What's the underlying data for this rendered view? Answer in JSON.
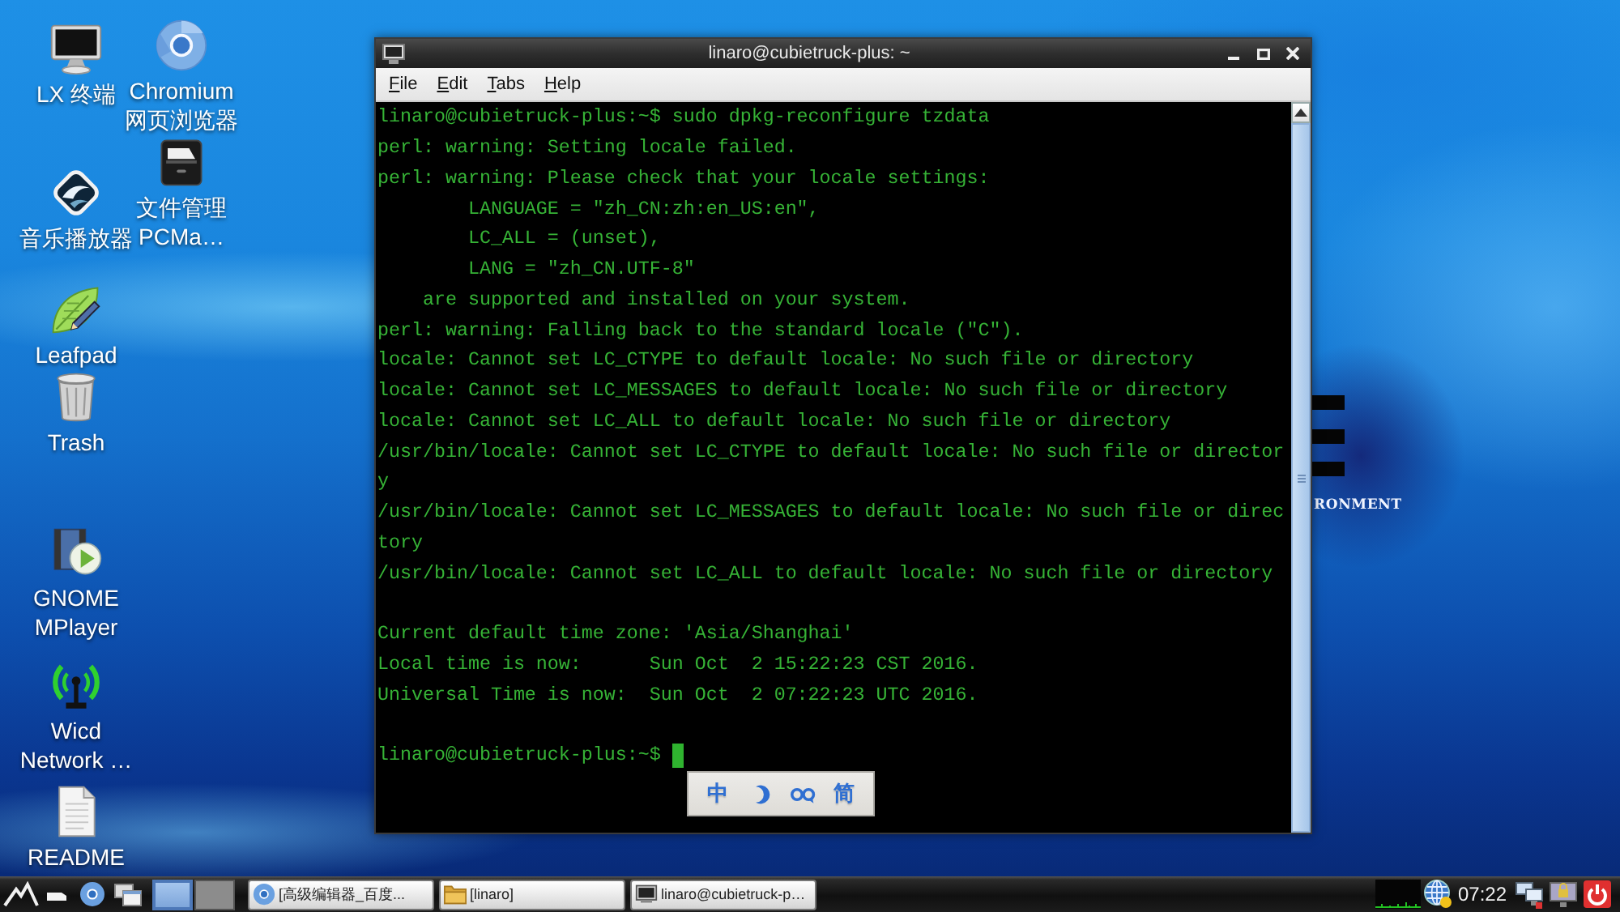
{
  "desktop": {
    "wallpaper_text": "RONMENT",
    "icons": [
      {
        "kind": "monitor",
        "label": [
          "LX 终端"
        ]
      },
      {
        "kind": "music",
        "label": [
          "音乐播放器"
        ]
      },
      {
        "kind": "editor",
        "label": [
          "Leafpad"
        ]
      },
      {
        "kind": "trash",
        "label": [
          "Trash"
        ]
      },
      {
        "kind": "media",
        "label": [
          "GNOME",
          "MPlayer"
        ]
      },
      {
        "kind": "network",
        "label": [
          "Wicd",
          "Network …"
        ]
      },
      {
        "kind": "document",
        "label": [
          "README"
        ]
      },
      {
        "kind": "browser",
        "label": [
          "Chromium",
          "网页浏览器"
        ]
      },
      {
        "kind": "files",
        "label": [
          "文件管理",
          "PCMa…"
        ]
      }
    ]
  },
  "terminal": {
    "title": "linaro@cubietruck-plus: ~",
    "menu": [
      "File",
      "Edit",
      "Tabs",
      "Help"
    ],
    "lines": [
      {
        "kind": "text",
        "text": "linaro@cubietruck-plus:~$ sudo dpkg-reconfigure tzdata"
      },
      {
        "kind": "text",
        "text": "perl: warning: Setting locale failed."
      },
      {
        "kind": "text",
        "text": "perl: warning: Please check that your locale settings:"
      },
      {
        "kind": "text",
        "text": "        LANGUAGE = \"zh_CN:zh:en_US:en\","
      },
      {
        "kind": "text",
        "text": "        LC_ALL = (unset),"
      },
      {
        "kind": "text",
        "text": "        LANG = \"zh_CN.UTF-8\""
      },
      {
        "kind": "text",
        "text": "    are supported and installed on your system."
      },
      {
        "kind": "text",
        "text": "perl: warning: Falling back to the standard locale (\"C\")."
      },
      {
        "kind": "text",
        "text": "locale: Cannot set LC_CTYPE to default locale: No such file or directory"
      },
      {
        "kind": "text",
        "text": "locale: Cannot set LC_MESSAGES to default locale: No such file or directory"
      },
      {
        "kind": "text",
        "text": "locale: Cannot set LC_ALL to default locale: No such file or directory"
      },
      {
        "kind": "text",
        "text": "/usr/bin/locale: Cannot set LC_CTYPE to default locale: No such file or director"
      },
      {
        "kind": "text",
        "text": "y"
      },
      {
        "kind": "text",
        "text": "/usr/bin/locale: Cannot set LC_MESSAGES to default locale: No such file or direc"
      },
      {
        "kind": "text",
        "text": "tory"
      },
      {
        "kind": "text",
        "text": "/usr/bin/locale: Cannot set LC_ALL to default locale: No such file or directory"
      },
      {
        "kind": "blank"
      },
      {
        "kind": "text",
        "text": "Current default time zone: 'Asia/Shanghai'"
      },
      {
        "kind": "text",
        "text": "Local time is now:      Sun Oct  2 15:22:23 CST 2016."
      },
      {
        "kind": "text",
        "text": "Universal Time is now:  Sun Oct  2 07:22:23 UTC 2016."
      },
      {
        "kind": "blank"
      },
      {
        "kind": "text",
        "text": "linaro@cubietruck-plus:~$"
      }
    ],
    "cursor": true
  },
  "ime_toolbar": {
    "items": [
      {
        "kind": "text",
        "text": "中"
      },
      {
        "kind": "moon"
      },
      {
        "kind": "quotes"
      },
      {
        "kind": "text",
        "text": "简"
      }
    ]
  },
  "taskbar": {
    "pager": [
      {
        "selected": true
      },
      {
        "selected": false
      }
    ],
    "tasks": [
      {
        "kind": "browser",
        "label": "[高级编辑器_百度..."
      },
      {
        "kind": "folder",
        "label": "[linaro]"
      },
      {
        "kind": "terminal",
        "label": "linaro@cubietruck-p…"
      }
    ],
    "clock": "07:22"
  }
}
